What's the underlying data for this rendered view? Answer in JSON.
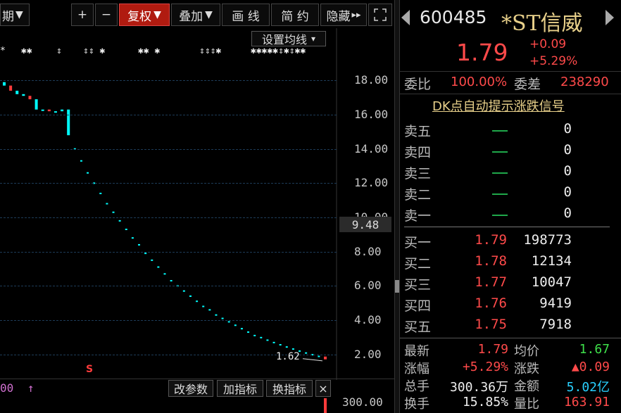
{
  "toolbar": {
    "period_label": "期",
    "period_arrow": "▼",
    "plus": "+",
    "minus": "−",
    "fuquan": "复权",
    "fuquan_arrow": "▼",
    "diejia": "叠加",
    "diejia_arrow": "▼",
    "huaxian": "画 线",
    "jianyue": "简 约",
    "yincang": "隐藏",
    "yincang_arrow": "▸▸",
    "expand_icon": "expand-icon"
  },
  "chart": {
    "ma_settings": "设置均线",
    "ma_settings_arrow": "▾",
    "current_price_tag": "9.48",
    "last_label": "1.62",
    "volume_axis": "300.00",
    "bottom_left": "00",
    "bottom_arrow": "↑",
    "marker_s": "S",
    "y_ticks": [
      "18.00",
      "16.00",
      "14.00",
      "12.00",
      "10.00",
      "8.00",
      "6.00",
      "4.00",
      "2.00"
    ],
    "buttons": [
      "改参数",
      "加指标",
      "换指标"
    ],
    "close_icon": "×",
    "colors": {
      "up": "#ff3b3b",
      "down": "#00ffff",
      "grid": "#1d3b57"
    }
  },
  "chart_data": {
    "type": "candlestick",
    "ylim": [
      1.0,
      19.0
    ],
    "series": [
      {
        "name": "",
        "values": [
          17.7,
          17.4,
          17.2,
          17.1,
          16.9,
          16.3,
          16.3,
          16.2,
          16.2,
          16.3,
          14.8,
          14.0,
          13.3,
          12.6,
          12.0,
          11.4,
          10.8,
          10.3,
          9.8,
          9.3,
          8.8,
          8.4,
          7.9,
          7.5,
          7.1,
          6.7,
          6.3,
          6.0,
          5.7,
          5.4,
          5.1,
          4.8,
          4.6,
          4.3,
          4.1,
          3.9,
          3.7,
          3.5,
          3.3,
          3.1,
          2.98,
          2.83,
          2.69,
          2.56,
          2.43,
          2.31,
          2.19,
          2.08,
          1.98,
          1.88,
          1.79
        ]
      }
    ]
  },
  "quote": {
    "code": "600485",
    "name": "*ST信威",
    "price": "1.79",
    "change": "+0.09",
    "change_pct": "+5.29%",
    "weibi_label": "委比",
    "weibi_value": "100.00%",
    "weicha_label": "委差",
    "weicha_value": "238290",
    "signal_link": "DK点自动提示涨跌信号",
    "sell": [
      {
        "label": "卖五",
        "price": "—",
        "vol": "0"
      },
      {
        "label": "卖四",
        "price": "—",
        "vol": "0"
      },
      {
        "label": "卖三",
        "price": "—",
        "vol": "0"
      },
      {
        "label": "卖二",
        "price": "—",
        "vol": "0"
      },
      {
        "label": "卖一",
        "price": "—",
        "vol": "0"
      }
    ],
    "buy": [
      {
        "label": "买一",
        "price": "1.79",
        "vol": "198773"
      },
      {
        "label": "买二",
        "price": "1.78",
        "vol": "12134"
      },
      {
        "label": "买三",
        "price": "1.77",
        "vol": "10047"
      },
      {
        "label": "买四",
        "price": "1.76",
        "vol": "9419"
      },
      {
        "label": "买五",
        "price": "1.75",
        "vol": "7918"
      }
    ],
    "stats": {
      "latest_label": "最新",
      "latest_value": "1.79",
      "avg_label": "均价",
      "avg_value": "1.67",
      "zf_label": "涨幅",
      "zf_value": "+5.29%",
      "zd_label": "涨跌",
      "zd_value": "▲0.09",
      "zs_label": "总手",
      "zs_value": "300.36万",
      "je_label": "金额",
      "je_value": "5.02亿",
      "hs_label": "换手",
      "hs_value": "15.85%",
      "lb_label": "量比",
      "lb_value": "163.91"
    }
  }
}
